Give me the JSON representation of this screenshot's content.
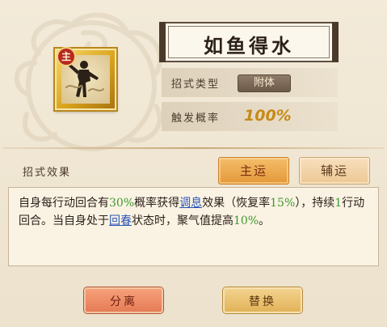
{
  "skill": {
    "title": "如鱼得水",
    "main_badge": "主",
    "type_label": "招式类型",
    "type_value": "附体",
    "trigger_label": "触发概率",
    "trigger_value": "100%"
  },
  "effects": {
    "label": "招式效果",
    "tabs": {
      "main": "主运",
      "aux": "辅运"
    },
    "description": {
      "p1": "自身每行动回合有",
      "v1": "30%",
      "p2": "概率获得",
      "link1": "调息",
      "p3": "效果（恢复率",
      "v2": "15%",
      "p4": "），持续",
      "v3": "1",
      "p5": "行动回合。当自身处于",
      "link2": "回春",
      "p6": "状态时，聚气值提高",
      "v4": "10%",
      "p7": "。"
    }
  },
  "buttons": {
    "split": "分离",
    "replace": "替换"
  },
  "colors": {
    "highlight_green": "#3f9a2f",
    "link_blue": "#2a55b8",
    "rate_gold": "#c78a16",
    "main_tab": "#e39938"
  },
  "icons": {
    "skill_icon": "dancing-figure-icon",
    "decoration": "swirl-cloud-decoration"
  }
}
